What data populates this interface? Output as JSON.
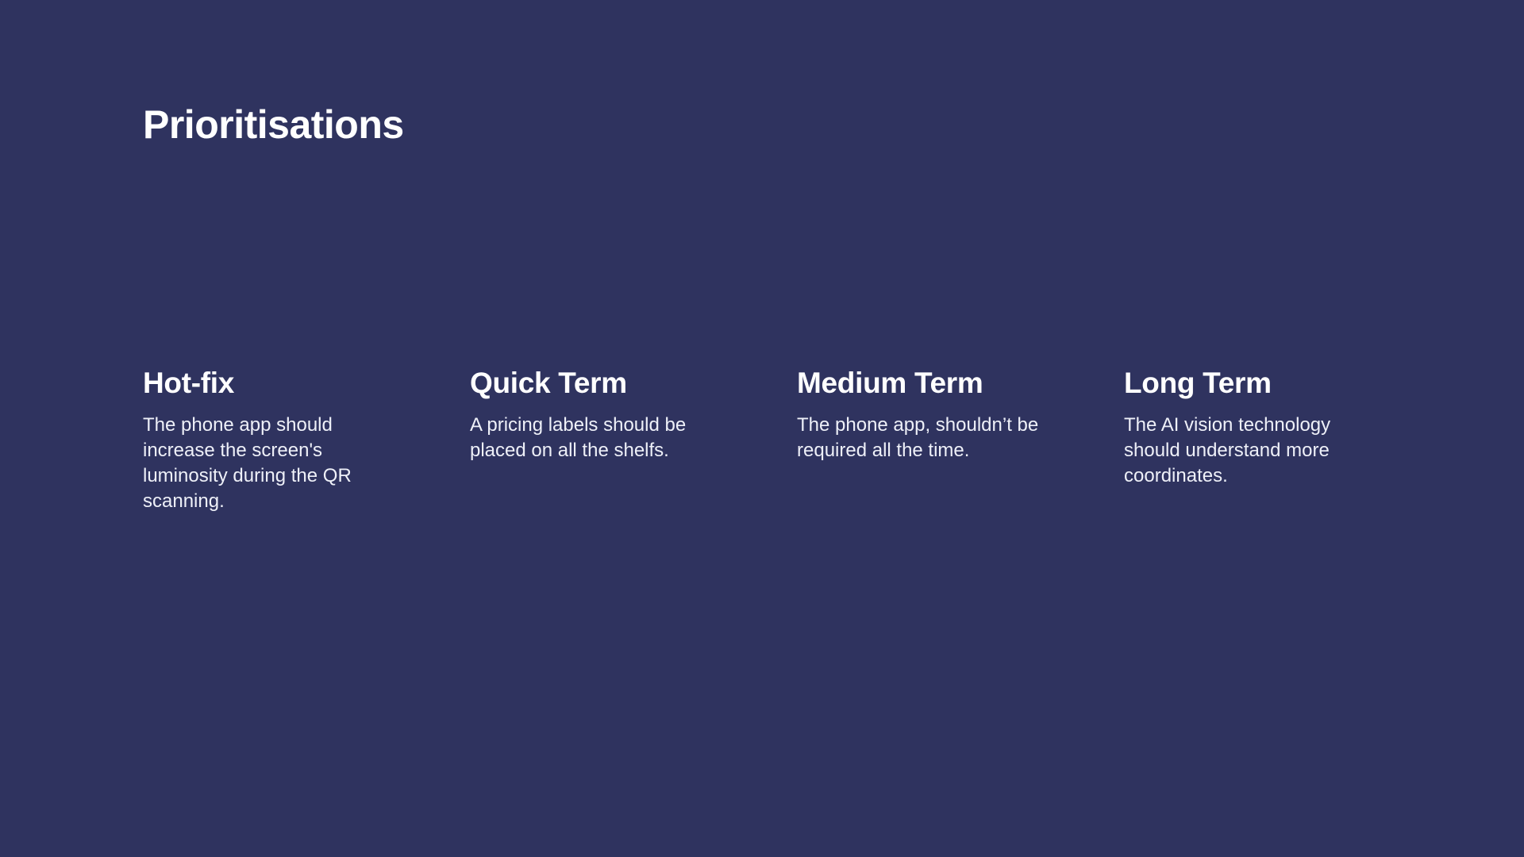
{
  "slide": {
    "background_color": "#2f335f",
    "text_color": "#ffffff",
    "title": "Prioritisations",
    "columns": [
      {
        "heading": "Hot-fix",
        "text": "The phone app should increase the screen's luminosity during the QR scanning."
      },
      {
        "heading": "Quick Term",
        "text": "A pricing labels should be placed on all the shelfs."
      },
      {
        "heading": "Medium Term",
        "text": "The phone app, shouldn’t be required all the time."
      },
      {
        "heading": "Long Term",
        "text": "The AI vision technology should understand more coordinates."
      }
    ]
  }
}
